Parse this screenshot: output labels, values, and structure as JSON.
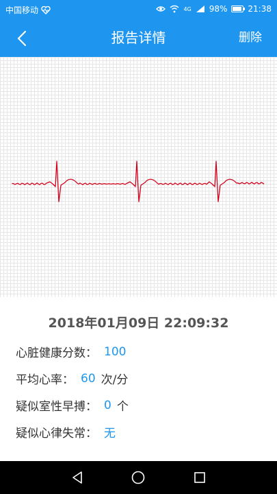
{
  "status_bar": {
    "carrier": "中国移动",
    "network": "4G",
    "battery": "98%",
    "time": "21:38"
  },
  "header": {
    "title": "报告详情",
    "delete_label": "删除"
  },
  "report": {
    "datetime": "2018年01月09日 22:09:32",
    "metrics": [
      {
        "label": "心脏健康分数：",
        "value": "100",
        "unit": ""
      },
      {
        "label": "平均心率：",
        "value": "60",
        "unit": "次/分"
      },
      {
        "label": "疑似室性早搏：",
        "value": "0",
        "unit": "个"
      },
      {
        "label": "疑似心律失常：",
        "value": "无",
        "unit": ""
      }
    ]
  },
  "colors": {
    "primary": "#1e96f0",
    "ecg_line": "#d0021b",
    "nav_bg": "#000000"
  }
}
